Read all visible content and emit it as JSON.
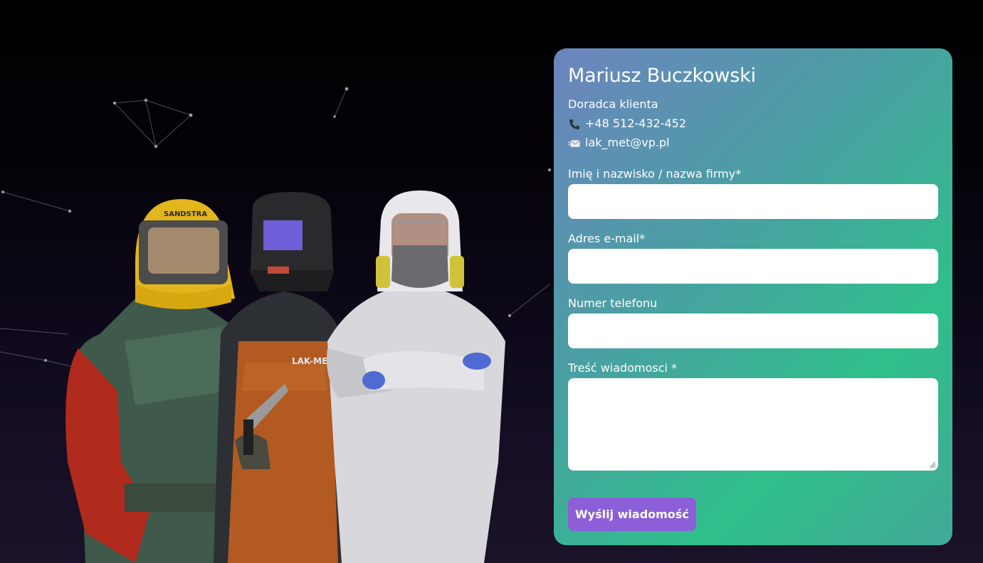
{
  "contact": {
    "name": "Mariusz Buczkowski",
    "role": "Doradca klienta",
    "phone": "+48 512-432-452",
    "email": "lak_met@vp.pl",
    "phone_icon": "phone-icon",
    "email_icon": "envelope-icon"
  },
  "form": {
    "name_label": "Imię i nazwisko / nazwa firmy*",
    "email_label": "Adres e-mail*",
    "phone_label": "Numer telefonu",
    "message_label": "Treść wiadomosci *",
    "name_value": "",
    "email_value": "",
    "phone_value": "",
    "message_value": "",
    "submit_label": "Wyślij wiadomość"
  },
  "photo": {
    "helmet_text": "SANDSTRA",
    "apron_text": "LAK-ME"
  },
  "colors": {
    "card_gradient_start": "#6d84bf",
    "card_gradient_end": "#2fbf8a",
    "submit_button": "#8c5fd8",
    "page_background": "#000000"
  }
}
